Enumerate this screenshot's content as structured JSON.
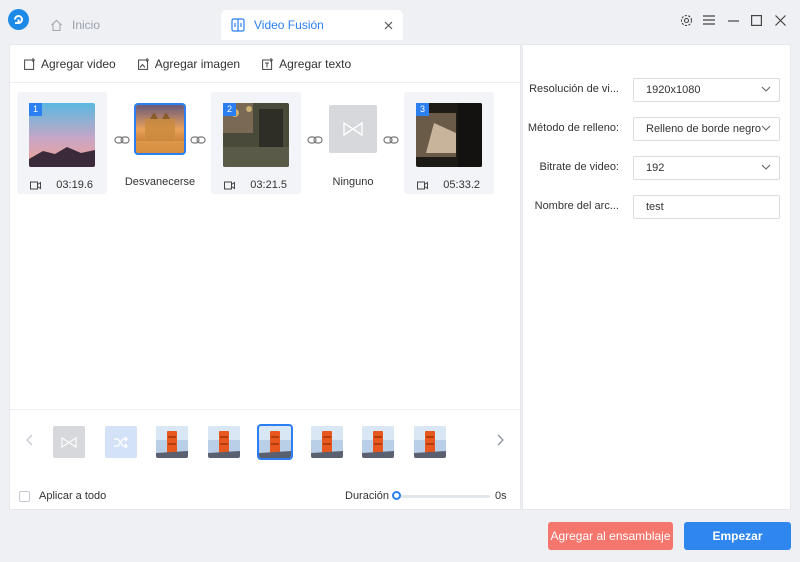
{
  "tabs": {
    "home_label": "Inicio",
    "active_label": "Video Fusión"
  },
  "toolbar": {
    "add_video": "Agregar video",
    "add_image": "Agregar imagen",
    "add_text": "Agregar texto"
  },
  "clips": [
    {
      "index": "1",
      "duration": "03:19.6"
    },
    {
      "index": "2",
      "duration": "03:21.5"
    },
    {
      "index": "3",
      "duration": "05:33.2"
    }
  ],
  "transitions": [
    {
      "label": "Desvanecerse"
    },
    {
      "label": "Ninguno"
    }
  ],
  "bottom": {
    "apply_all": "Aplicar a todo",
    "duration_label": "Duración",
    "duration_value": "0s",
    "duration_fraction": 0
  },
  "settings": {
    "resolution_label": "Resolución de vi...",
    "resolution_value": "1920x1080",
    "fill_label": "Método de relleno:",
    "fill_value": "Relleno de borde negro",
    "bitrate_label": "Bitrate de video:",
    "bitrate_value": "192",
    "filename_label": "Nombre del arc...",
    "filename_value": "test"
  },
  "buttons": {
    "add_to_assembly": "Agregar al ensamblaje",
    "start": "Empezar"
  },
  "colors": {
    "accent": "#2b7ff0",
    "add_button": "#f4766d",
    "start_button": "#2f86ee"
  }
}
